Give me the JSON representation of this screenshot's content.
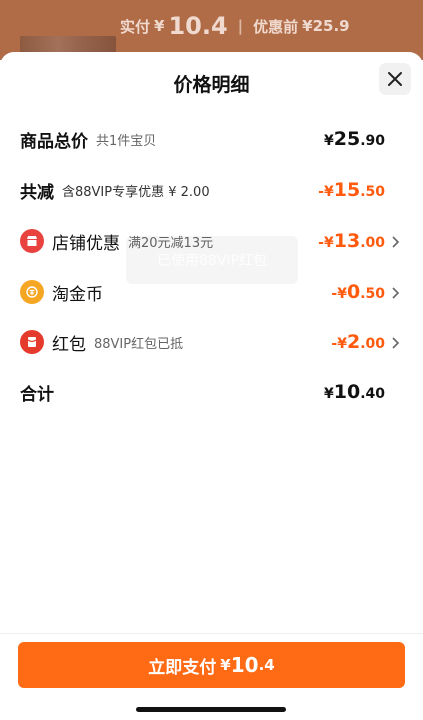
{
  "banner": {
    "paid_label": "实付",
    "paid_currency": "¥",
    "paid_amount": "10.4",
    "before_label": "优惠前",
    "before_amount": "¥25.9"
  },
  "sheet": {
    "title": "价格明细"
  },
  "rows": {
    "total": {
      "label": "商品总价",
      "sub": "共1件宝贝",
      "cur": "¥",
      "int": "25",
      "dec": ".90"
    },
    "reduce": {
      "label": "共减",
      "sub": "含88VIP专享优惠 ¥ 2.00",
      "cur": "-¥",
      "int": "15",
      "dec": ".50"
    },
    "shop": {
      "label": "店铺优惠",
      "sub": "满20元减13元",
      "cur": "-¥",
      "int": "13",
      "dec": ".00"
    },
    "coin": {
      "label": "淘金币",
      "cur": "-¥",
      "int": "0",
      "dec": ".50"
    },
    "redpacket": {
      "label": "红包",
      "sub": "88VIP红包已抵",
      "cur": "-¥",
      "int": "2",
      "dec": ".00"
    },
    "sum": {
      "label": "合计",
      "cur": "¥",
      "int": "10",
      "dec": ".40"
    }
  },
  "toast": {
    "text": "已使用88VIP红包"
  },
  "pay": {
    "label": "立即支付",
    "cur": "¥",
    "int": "10",
    "dec": ".4"
  },
  "colors": {
    "accent": "#ff6a14",
    "discount": "#ff5a0e",
    "shop_icon": "#e8433f",
    "coin_icon": "#f5a623",
    "redpacket_icon": "#e43b2c"
  },
  "icons": {
    "close": "close-icon",
    "shop": "shop-icon",
    "coin": "coin-icon",
    "redpacket": "red-packet-icon",
    "chevron": "chevron-right-icon"
  }
}
